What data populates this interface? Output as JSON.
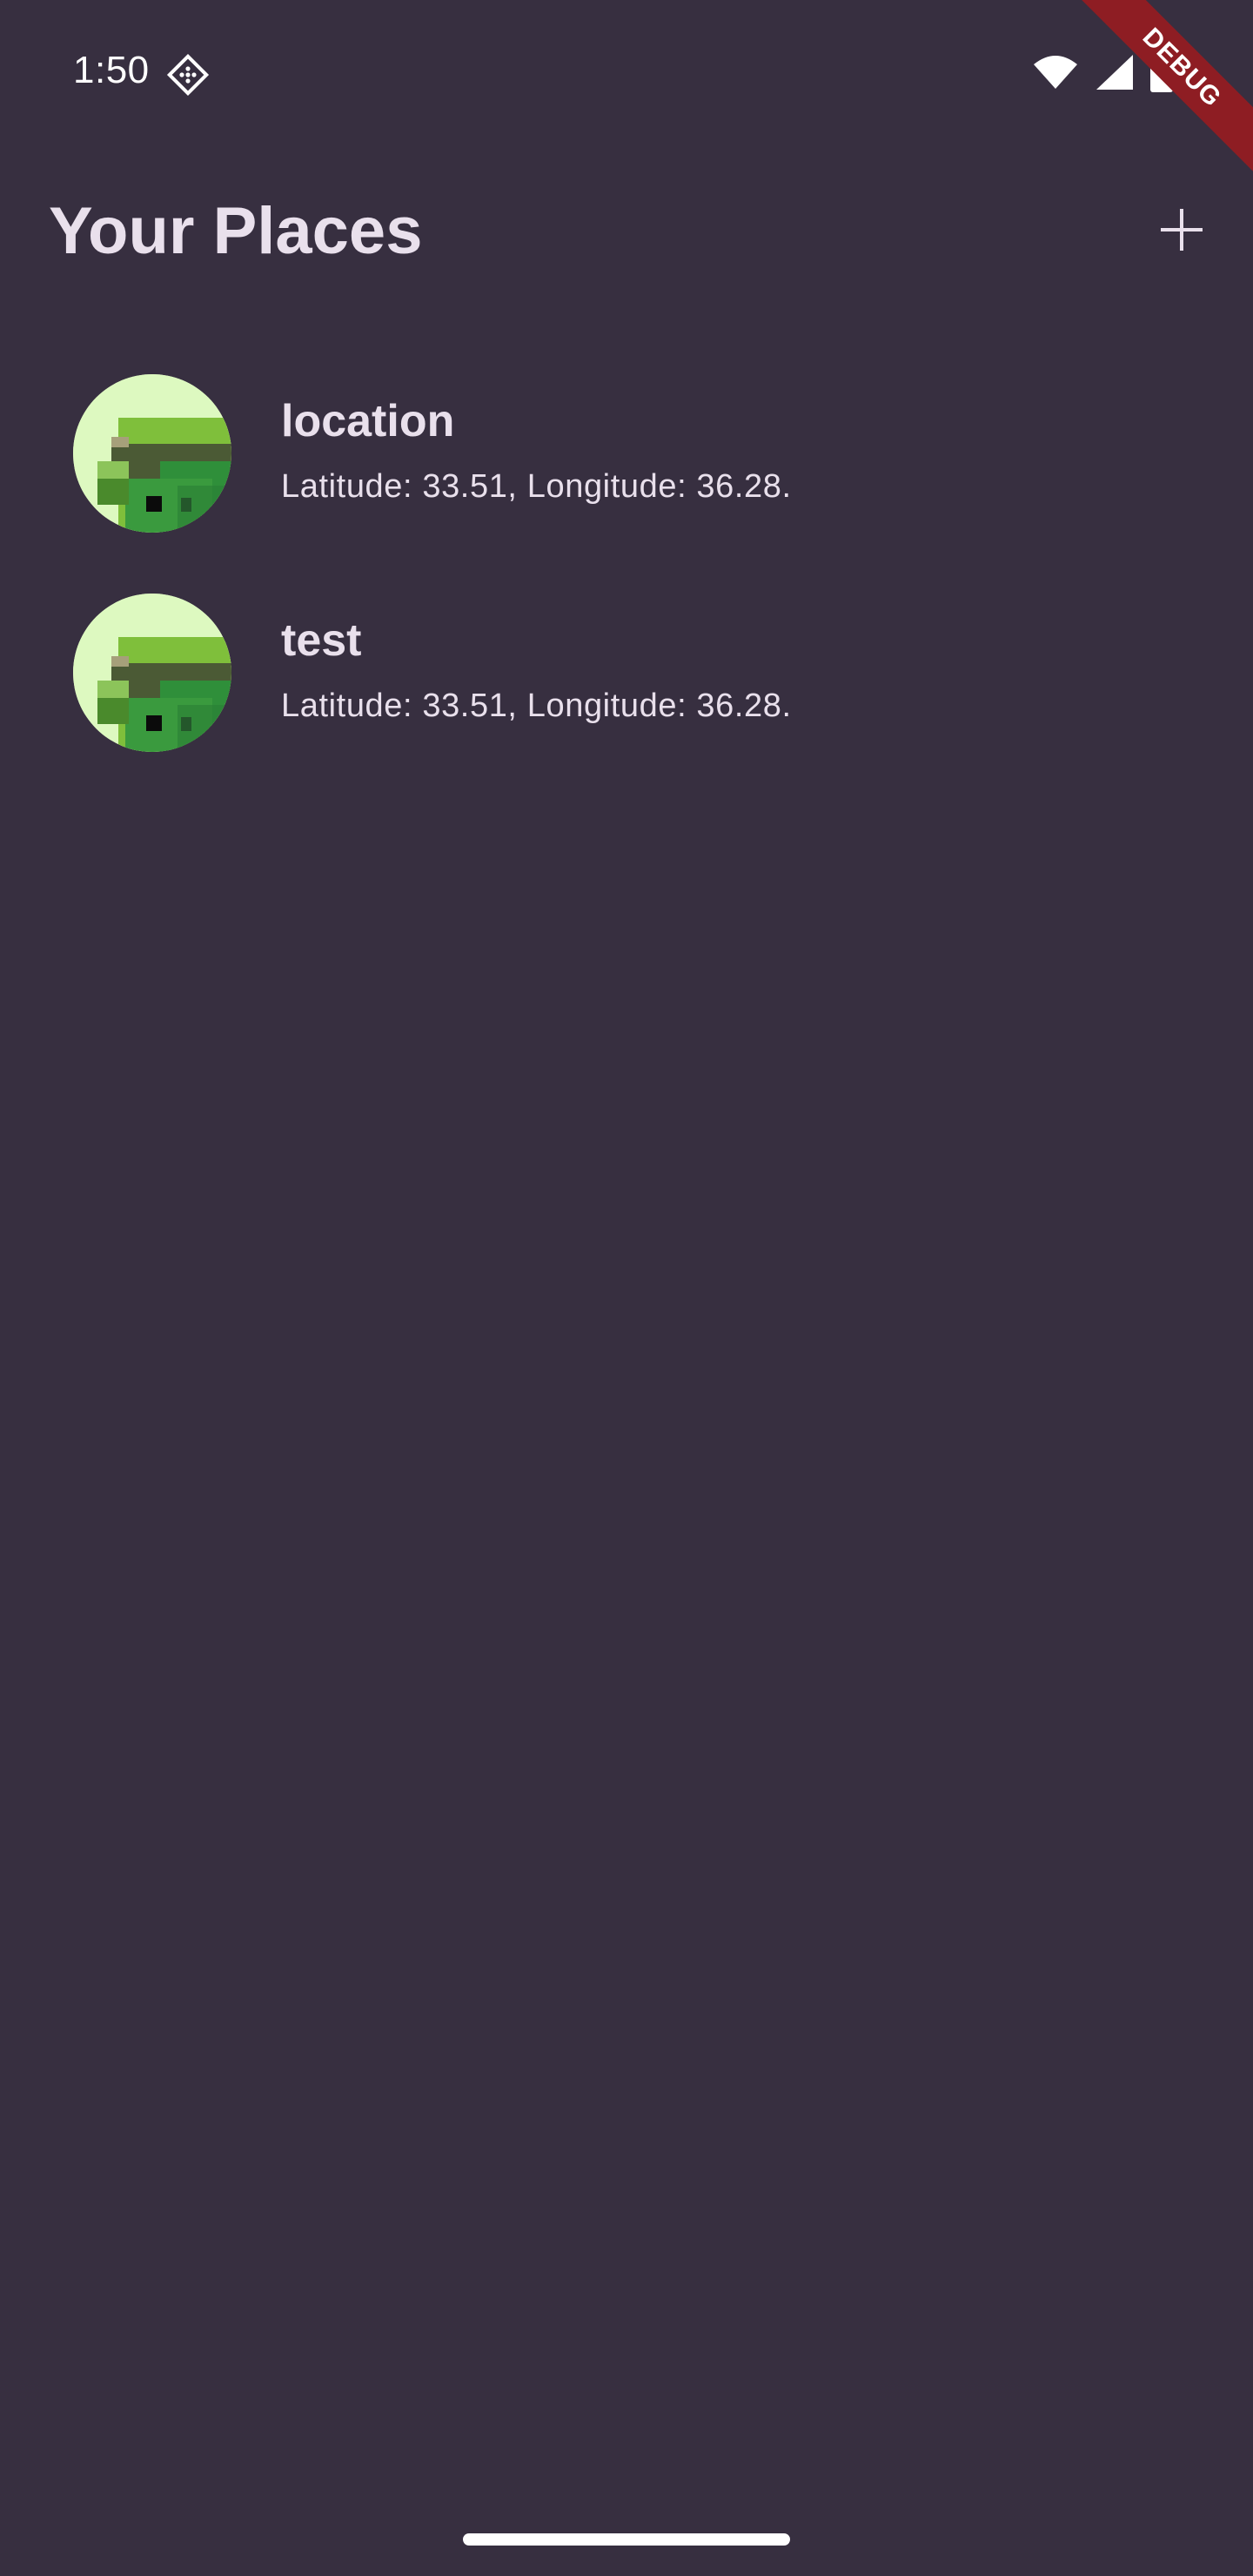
{
  "status_bar": {
    "time": "1:50",
    "icons": [
      "notification-diamond-icon",
      "wifi-icon",
      "cell-signal-icon",
      "battery-icon"
    ]
  },
  "debug_banner": {
    "label": "DEBUG"
  },
  "app_bar": {
    "title": "Your Places",
    "add_icon": "plus-icon"
  },
  "places": [
    {
      "title": "location",
      "subtitle": "Latitude: 33.51, Longitude: 36.28.",
      "avatar": "map-thumbnail"
    },
    {
      "title": "test",
      "subtitle": "Latitude: 33.51, Longitude: 36.28.",
      "avatar": "map-thumbnail"
    }
  ],
  "colors": {
    "background": "#372f40",
    "text": "#e9e0ec",
    "debug": "#8e1d23"
  }
}
